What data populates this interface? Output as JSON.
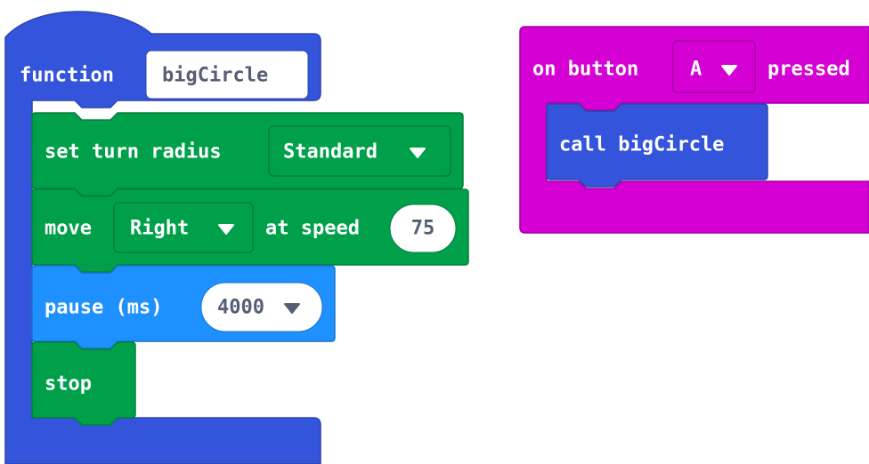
{
  "function_block": {
    "keyword": "function",
    "name": "bigCircle",
    "statements": [
      {
        "kind": "set-turn-radius",
        "label": "set turn radius",
        "dropdown_value": "Standard"
      },
      {
        "kind": "move",
        "label": "move",
        "dropdown_value": "Right",
        "speed_label": "at speed",
        "speed_value": "75"
      },
      {
        "kind": "pause",
        "label": "pause (ms)",
        "value": "4000"
      },
      {
        "kind": "stop",
        "label": "stop"
      }
    ]
  },
  "event_block": {
    "prefix": "on button",
    "button_value": "A",
    "suffix": "pressed",
    "statement": {
      "label": "call bigCircle"
    }
  },
  "icons": {
    "dropdown": "caret-down-icon"
  },
  "colors": {
    "functions": "#3455db",
    "functions_border": "#2a45b0",
    "motors": "#00a04a",
    "motors_border": "#00803b",
    "basic": "#1e90ff",
    "basic_border": "#1873cc",
    "input": "#d400d4",
    "input_border": "#a600a6",
    "field_bg": "#ffffff",
    "field_text": "#575e75"
  }
}
